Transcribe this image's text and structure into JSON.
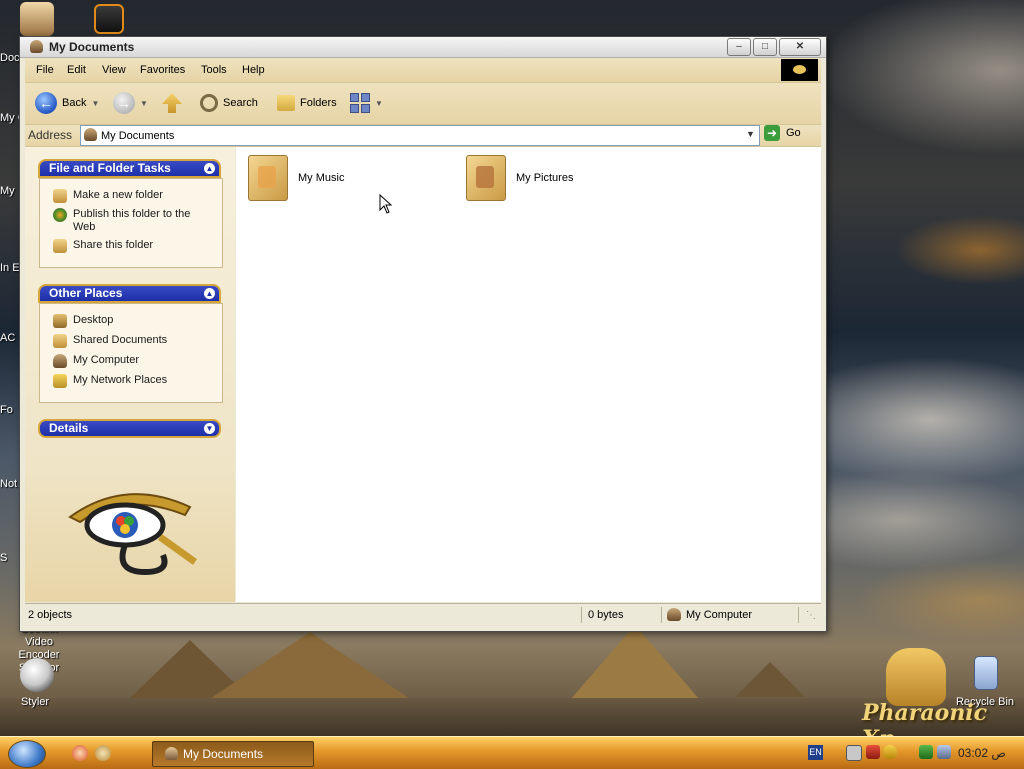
{
  "desktop": {
    "icons": [
      {
        "label": "Styler"
      },
      {
        "label": "Recycle Bin"
      },
      {
        "label": "Sothink Video Encoder\nSelector"
      }
    ],
    "left_clipped_labels": [
      "Docu",
      "My C",
      "My",
      "In Ex",
      "AC Ph",
      "Fo",
      "Not",
      "S"
    ],
    "brand_text": "Pharaonic Xp"
  },
  "window": {
    "title": "My Documents",
    "controls": {
      "minimize": "–",
      "maximize": "□",
      "close": "✕"
    },
    "menu": [
      "File",
      "Edit",
      "View",
      "Favorites",
      "Tools",
      "Help"
    ],
    "toolbar": {
      "back": "Back",
      "search": "Search",
      "folders": "Folders"
    },
    "address": {
      "label": "Address",
      "value": "My Documents",
      "go": "Go"
    },
    "tasks": {
      "file_folder": {
        "title": "File and Folder Tasks",
        "items": [
          "Make a new folder",
          "Publish this folder to the Web",
          "Share this folder"
        ]
      },
      "other_places": {
        "title": "Other Places",
        "items": [
          "Desktop",
          "Shared Documents",
          "My Computer",
          "My Network Places"
        ]
      },
      "details": {
        "title": "Details"
      }
    },
    "folders": [
      {
        "name": "My Music"
      },
      {
        "name": "My Pictures"
      }
    ],
    "status": {
      "objects": "2 objects",
      "size": "0 bytes",
      "location": "My Computer"
    }
  },
  "taskbar": {
    "task_label": "My Documents",
    "language": "EN",
    "clock": "03:02 ص"
  },
  "colors": {
    "taskbar": "#e3972a",
    "taskpane_header": "#1c2fa8",
    "header_border": "#d7a63b",
    "papyrus": "#efe2bf"
  }
}
